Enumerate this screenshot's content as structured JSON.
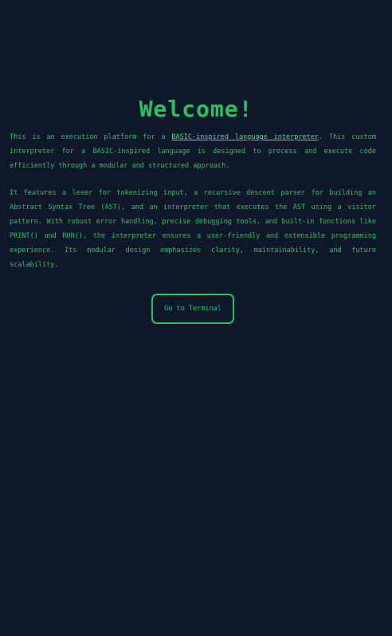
{
  "header": {
    "title": "Welcome!"
  },
  "intro": {
    "para1_before_link": "This is an execution platform for a ",
    "para1_link": "BASIC-inspired language interpreter",
    "para1_after_link": ". This custom interpreter for a BASIC-inspired language is designed to process and execute code efficiently through a modular and structured approach.",
    "para2": "It features a lexer for tokenizing input, a recursive descent parser for building an Abstract Syntax Tree (AST), and an interpreter that executes the AST using a visitor pattern. With robust error handling, precise debugging tools, and built-in functions like PRINT() and RUN(), the interpreter ensures a user-friendly and extensible programming experience. Its modular design emphasizes clarity, maintainability, and future scalability."
  },
  "actions": {
    "terminal_button_label": "Go to Terminal"
  },
  "colors": {
    "background": "#0f172a",
    "accent": "#22c55e"
  }
}
